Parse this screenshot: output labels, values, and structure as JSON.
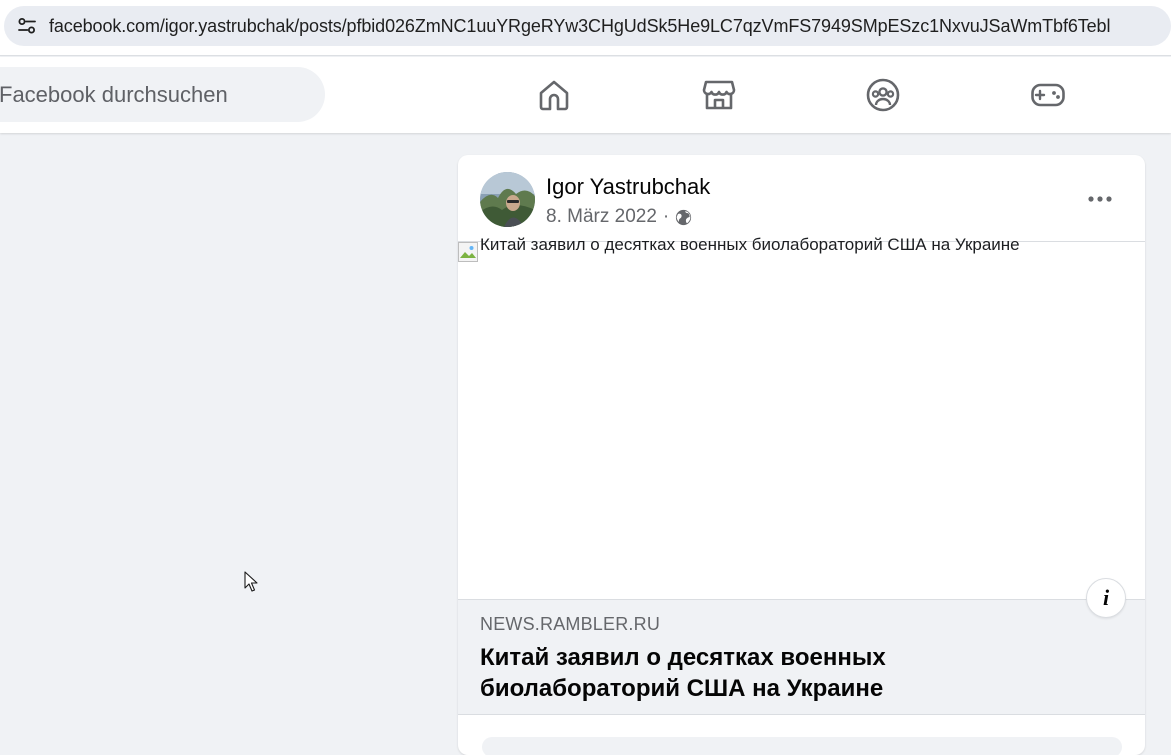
{
  "browser": {
    "url": "facebook.com/igor.yastrubchak/posts/pfbid026ZmNC1uuYRgeRYw3CHgUdSk5He9LC7qzVmFS7949SMpESzc1NxvuJSaWmTbf6Tebl",
    "site_info_icon": "tune-icon"
  },
  "fb_nav": {
    "search_placeholder": "Facebook durchsuchen",
    "icons": [
      "home-icon",
      "marketplace-icon",
      "groups-icon",
      "gaming-icon"
    ]
  },
  "post": {
    "author": "Igor Yastrubchak",
    "date": "8. März 2022",
    "separator": "·",
    "privacy_icon": "globe-icon",
    "more_icon": "more-dots-icon",
    "image_alt": "Китай заявил о десятках военных биолабораторий США на Украине",
    "info_label": "i",
    "link": {
      "domain": "NEWS.RAMBLER.RU",
      "title": "Китай заявил о десятках военных биолабораторий США на Украине"
    }
  }
}
